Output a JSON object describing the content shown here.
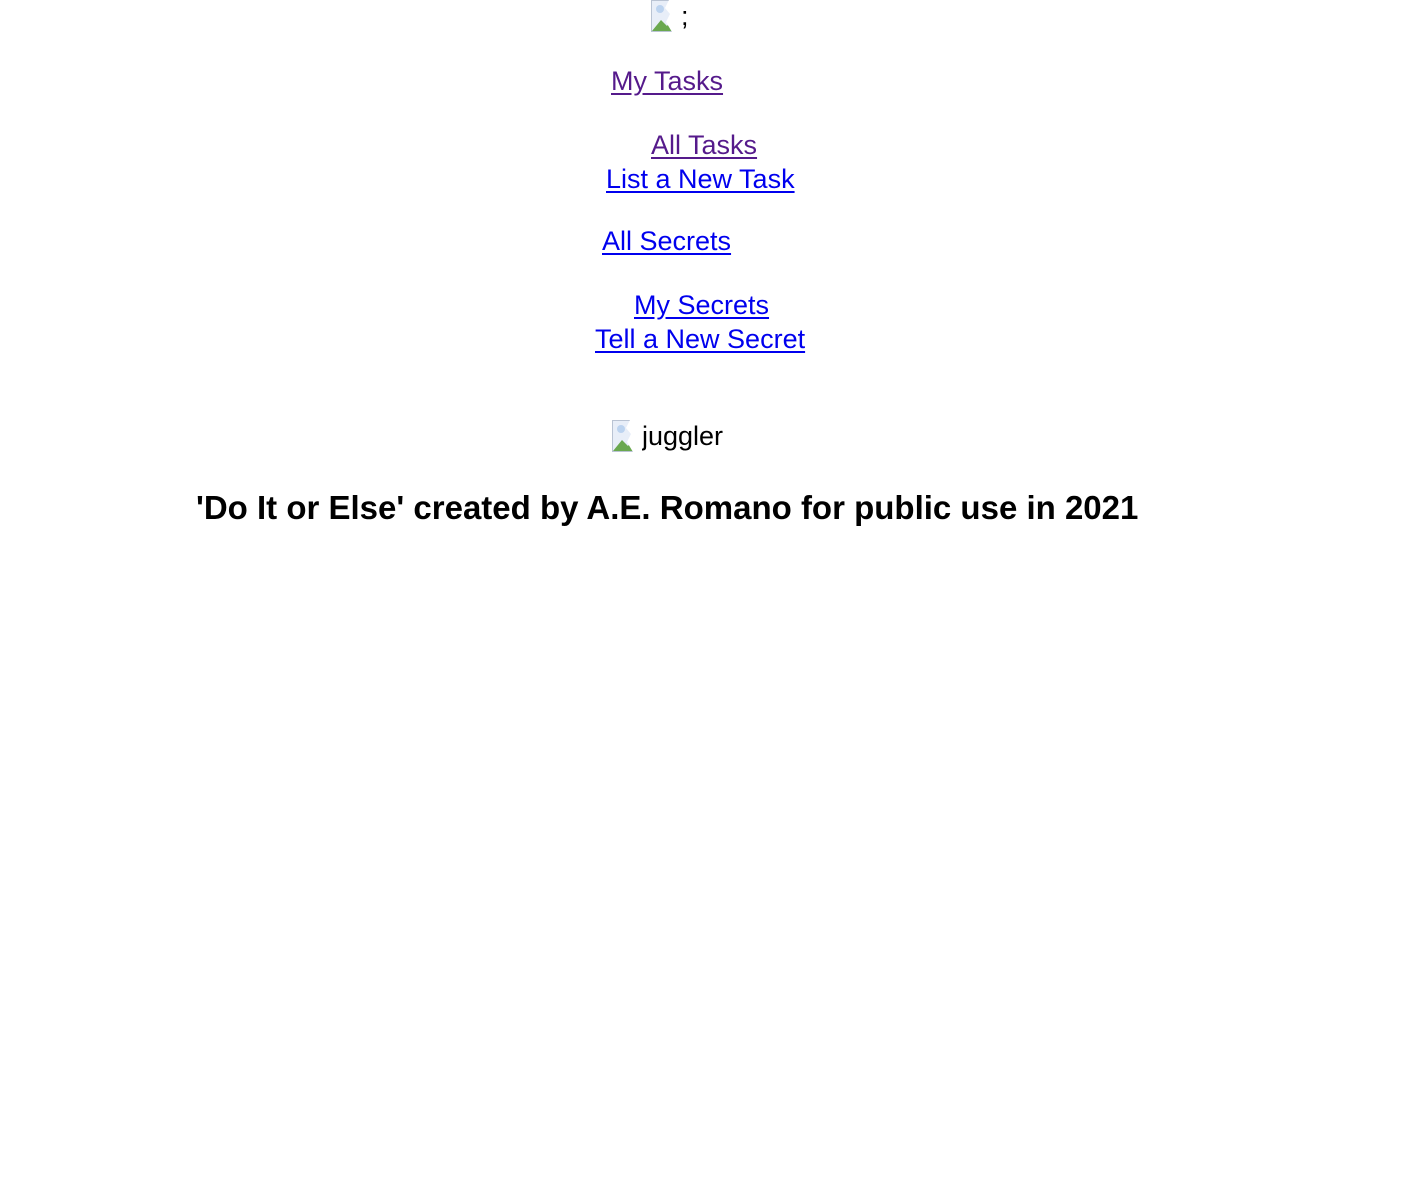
{
  "header": {
    "logo_alt": ";"
  },
  "nav": {
    "tasks": {
      "my_tasks": "My Tasks",
      "all_tasks": "All Tasks",
      "new_task": "List a New Task"
    },
    "secrets": {
      "all_secrets": "All Secrets",
      "my_secrets": "My Secrets",
      "new_secret": "Tell a New Secret"
    }
  },
  "main": {
    "image_alt": "juggler"
  },
  "footer": {
    "credit": "'Do It or Else' created by A.E. Romano for public use in 2021"
  },
  "colors": {
    "visited_link": "#551a8b",
    "unvisited_link": "#0000ee",
    "text": "#000000",
    "background": "#ffffff"
  }
}
